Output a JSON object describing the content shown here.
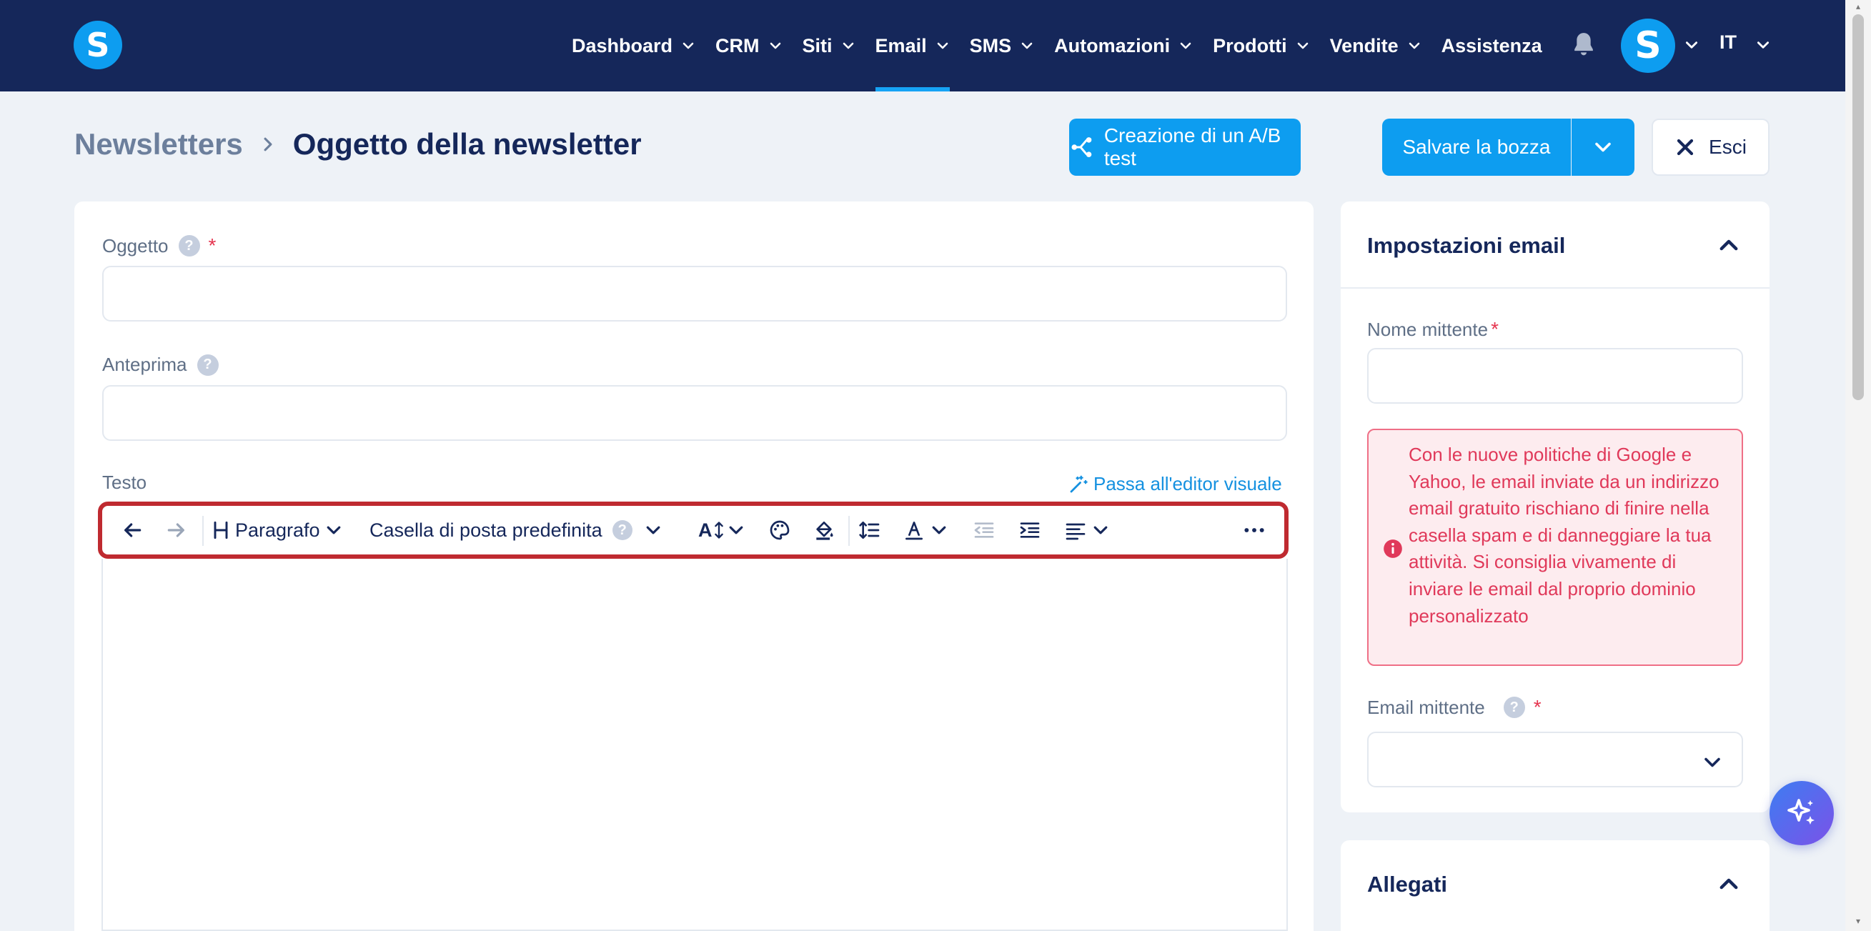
{
  "nav": {
    "logo_letter": "S",
    "items": [
      {
        "label": "Dashboard",
        "dropdown": true
      },
      {
        "label": "CRM",
        "dropdown": true
      },
      {
        "label": "Siti",
        "dropdown": true
      },
      {
        "label": "Email",
        "dropdown": true,
        "active": true
      },
      {
        "label": "SMS",
        "dropdown": true
      },
      {
        "label": "Automazioni",
        "dropdown": true
      },
      {
        "label": "Prodotti",
        "dropdown": true
      },
      {
        "label": "Vendite",
        "dropdown": true
      },
      {
        "label": "Assistenza",
        "dropdown": false
      }
    ],
    "avatar_letter": "S",
    "language": "IT"
  },
  "header": {
    "breadcrumb_parent": "Newsletters",
    "breadcrumb_current": "Oggetto della newsletter",
    "ab_test_label": "Creazione di un A/B test",
    "save_draft_label": "Salvare la bozza",
    "exit_label": "Esci"
  },
  "form": {
    "subject_label": "Oggetto",
    "subject_value": "",
    "preview_label": "Anteprima",
    "preview_value": "",
    "text_label": "Testo",
    "visual_editor_link": "Passa all'editor visuale",
    "help_glyph": "?",
    "required_glyph": "*"
  },
  "toolbar": {
    "paragraph_label": "Paragrafo",
    "mailbox_label": "Casella di posta predefinita",
    "font_size_glyph": "A"
  },
  "sidebar": {
    "email_settings_title": "Impostazioni email",
    "sender_name_label": "Nome mittente",
    "sender_name_value": "",
    "warning_text": "Con le nuove politiche di Google e Yahoo, le email inviate da un indirizzo email gratuito rischiano di finire nella casella spam e di danneggiare la tua attività. Si consiglia vivamente di inviare le email dal proprio dominio personalizzato",
    "sender_email_label": "Email mittente",
    "sender_email_value": "",
    "attachments_title": "Allegati"
  },
  "colors": {
    "nav_bg": "#15275a",
    "accent": "#0d9df0",
    "highlight_border": "#bf2a30",
    "warning_text": "#e0395a",
    "warning_bg": "#fdecef"
  }
}
